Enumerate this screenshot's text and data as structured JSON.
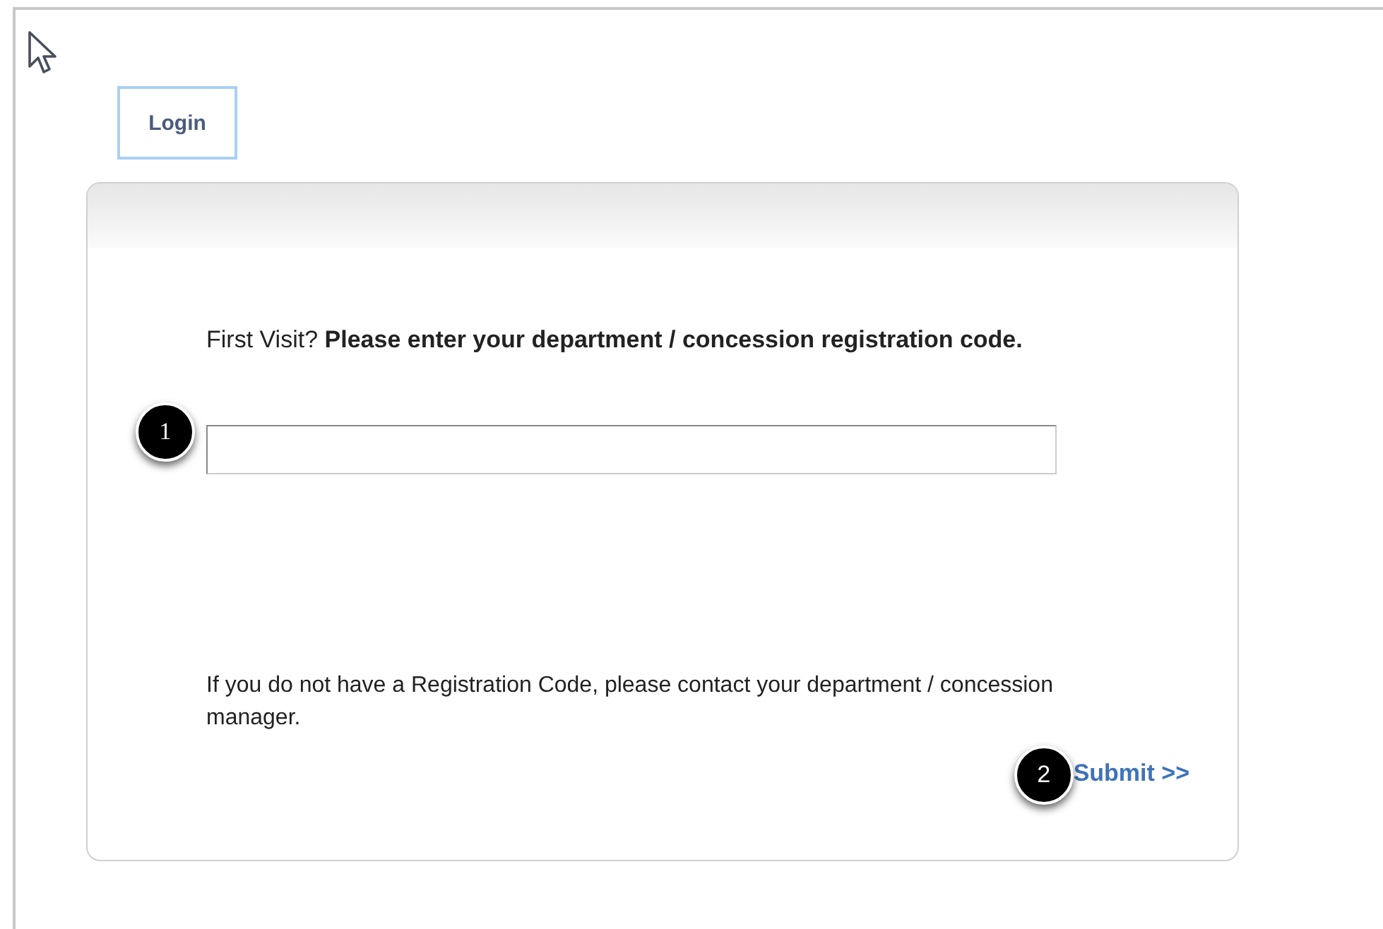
{
  "tab": {
    "label": "Login",
    "selected": true
  },
  "card": {
    "heading": "First Visit? **Please enter your department / concession registration code.**",
    "code_field": {
      "callout": "1"
    },
    "note": "If you do not have a Registration Code, please contact your department / concession manager.",
    "submit": {
      "label": "Submit >>",
      "callout": "2"
    }
  }
}
